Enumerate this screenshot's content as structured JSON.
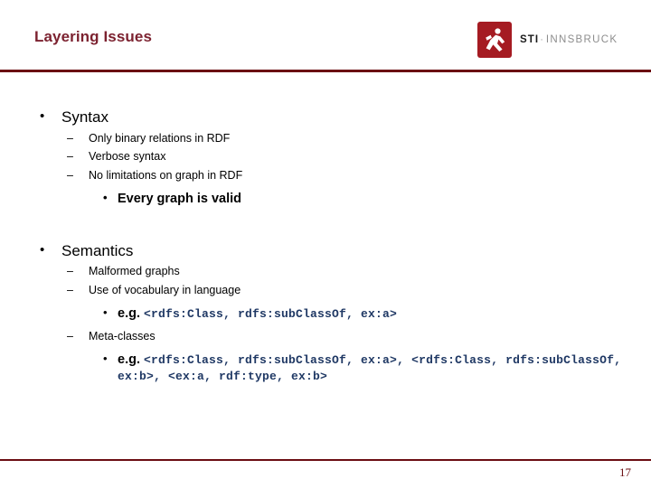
{
  "slide": {
    "title": "Layering Issues",
    "page_number": "17",
    "accent_color": "#6B0D12",
    "title_color": "#7C2230",
    "code_color": "#1F3864"
  },
  "logo": {
    "mark_name": "sti-figure-icon",
    "mark_color": "#A51B22",
    "sti": "STI",
    "separator": "·",
    "innsbruck": "INNSBRUCK"
  },
  "markers": {
    "level1": "•",
    "level2": "–",
    "level3": "•"
  },
  "sections": [
    {
      "heading": "Syntax",
      "items": [
        {
          "level": 2,
          "text": "Only binary relations in RDF"
        },
        {
          "level": 2,
          "text": "Verbose syntax"
        },
        {
          "level": 2,
          "text": "No limitations on graph in RDF"
        },
        {
          "level": 3,
          "text": "Every graph is valid"
        }
      ]
    },
    {
      "heading": "Semantics",
      "items": [
        {
          "level": 2,
          "text": "Malformed graphs"
        },
        {
          "level": 2,
          "text": "Use of vocabulary in language"
        },
        {
          "level": 3,
          "label": "e.g.",
          "code": "<rdfs:Class, rdfs:subClassOf, ex:a>"
        },
        {
          "level": 2,
          "text": "Meta-classes"
        },
        {
          "level": 3,
          "label": "e.g.",
          "code": "<rdfs:Class, rdfs:subClassOf, ex:a>, <rdfs:Class, rdfs:subClassOf, ex:b>, <ex:a, rdf:type, ex:b>"
        }
      ]
    }
  ]
}
